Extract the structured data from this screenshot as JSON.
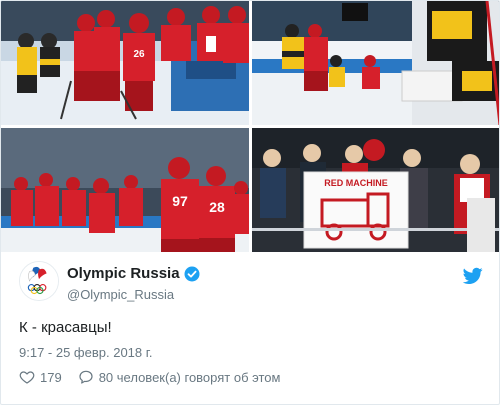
{
  "author": {
    "display_name": "Olympic Russia",
    "handle": "@Olympic_Russia",
    "verified": true
  },
  "tweet": {
    "text": "К - красавцы!",
    "timestamp": "9:17 - 25 февр. 2018 г."
  },
  "actions": {
    "like_count": "179",
    "reply_label": "80 человек(а) говорят об этом"
  },
  "photos": {
    "jersey_number": "26",
    "player_numbers": [
      "97",
      "28"
    ],
    "fan_sign": "RED MACHINE"
  },
  "colors": {
    "link_blue": "#1da1f2",
    "text": "#1c2022",
    "secondary": "#697882",
    "jersey_red": "#d6202b"
  }
}
